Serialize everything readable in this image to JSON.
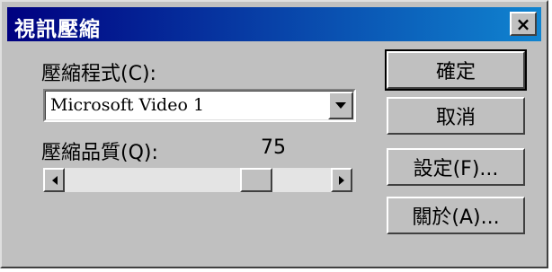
{
  "window": {
    "title": "視訊壓縮",
    "close_label": "×"
  },
  "compressor": {
    "label": "壓縮程式(C):",
    "selected": "Microsoft Video 1"
  },
  "quality": {
    "label": "壓縮品質(Q):",
    "value": "75",
    "fraction": 0.75
  },
  "buttons": {
    "ok": "確定",
    "cancel": "取消",
    "configure": "設定(F)...",
    "about": "關於(A)..."
  },
  "icons": {
    "dropdown": "chevron-down-icon",
    "scroll_left": "arrow-left-icon",
    "scroll_right": "arrow-right-icon",
    "close": "close-icon"
  },
  "colors": {
    "titlebar_start": "#000080",
    "titlebar_end": "#1084d0",
    "face": "#c0c0c0"
  }
}
